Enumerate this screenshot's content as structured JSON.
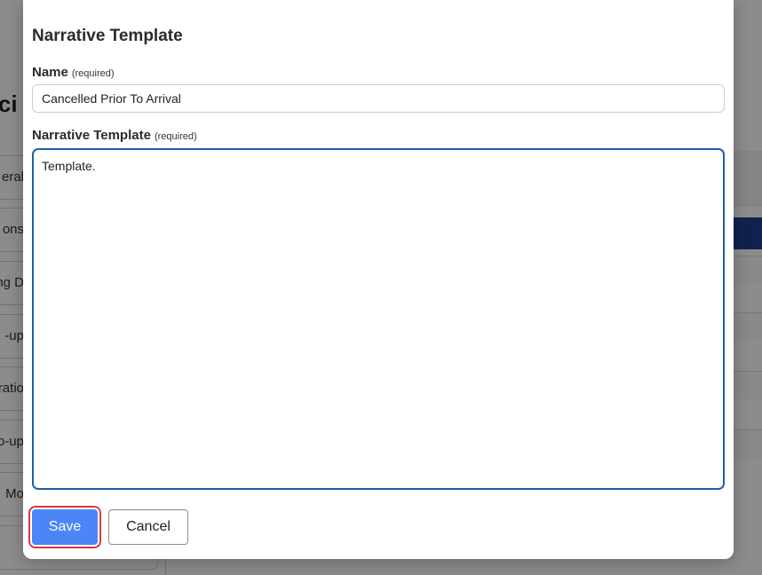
{
  "background": {
    "page_title_fragment": "nci",
    "nav_items": [
      {
        "label": "eral"
      },
      {
        "label": "ons"
      },
      {
        "label": "ng D"
      },
      {
        "label": "-up"
      },
      {
        "label": "ratio"
      },
      {
        "label": "o-up"
      },
      {
        "label": "Mo"
      },
      {
        "label": ""
      }
    ]
  },
  "modal": {
    "title": "Narrative Template",
    "name_field": {
      "label": "Name",
      "required_note": "(required)",
      "value": "Cancelled Prior To Arrival"
    },
    "template_field": {
      "label": "Narrative Template",
      "required_note": "(required)",
      "value": "Template."
    },
    "buttons": {
      "save": "Save",
      "cancel": "Cancel"
    }
  },
  "colors": {
    "primary_button": "#4a86f5",
    "focus_border": "#1f5fa8",
    "highlight_ring": "#d9393b"
  }
}
